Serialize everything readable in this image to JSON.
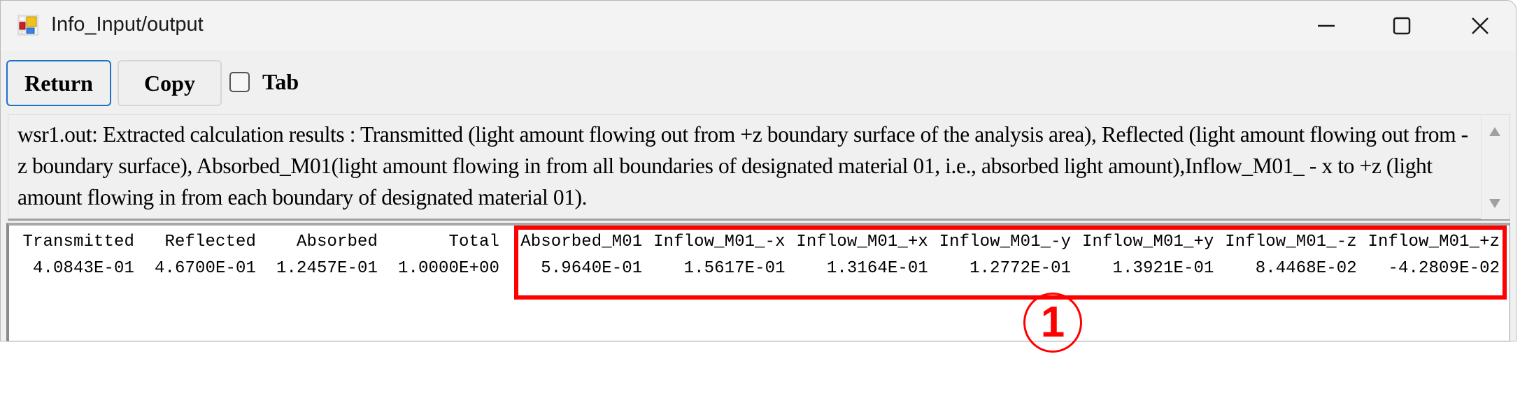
{
  "window": {
    "title": "Info_Input/output",
    "icons": {
      "app": "app-form-icon",
      "minimize": "minimize-icon",
      "maximize": "maximize-icon",
      "close": "close-icon"
    }
  },
  "toolbar": {
    "return_label": "Return",
    "copy_label": "Copy",
    "tab_checkbox": {
      "label": "Tab",
      "checked": false
    }
  },
  "description": {
    "text": "wsr1.out: Extracted calculation results : Transmitted (light amount flowing out from +z boundary surface of the analysis area), Reflected (light amount flowing out from -z boundary surface), Absorbed_M01(light amount flowing in from all boundaries of designated material 01, i.e., absorbed light amount),Inflow_M01_ - x to +z (light amount flowing in from each boundary of designated material 01)."
  },
  "output": {
    "columns": [
      {
        "header": "Transmitted",
        "value": "4.0843E-01"
      },
      {
        "header": "Reflected",
        "value": "4.6700E-01"
      },
      {
        "header": "Absorbed",
        "value": "1.2457E-01"
      },
      {
        "header": "Total",
        "value": "1.0000E+00"
      },
      {
        "header": "Absorbed_M01",
        "value": "5.9640E-01"
      },
      {
        "header": "Inflow_M01_-x",
        "value": "1.5617E-01"
      },
      {
        "header": "Inflow_M01_+x",
        "value": "1.3164E-01"
      },
      {
        "header": "Inflow_M01_-y",
        "value": "1.2772E-01"
      },
      {
        "header": "Inflow_M01_+y",
        "value": "1.3921E-01"
      },
      {
        "header": "Inflow_M01_-z",
        "value": "8.4468E-02"
      },
      {
        "header": "Inflow_M01_+z",
        "value": "-4.2809E-02"
      }
    ]
  },
  "annotation": {
    "marker_label": "1",
    "highlight_color": "#ff0000"
  }
}
